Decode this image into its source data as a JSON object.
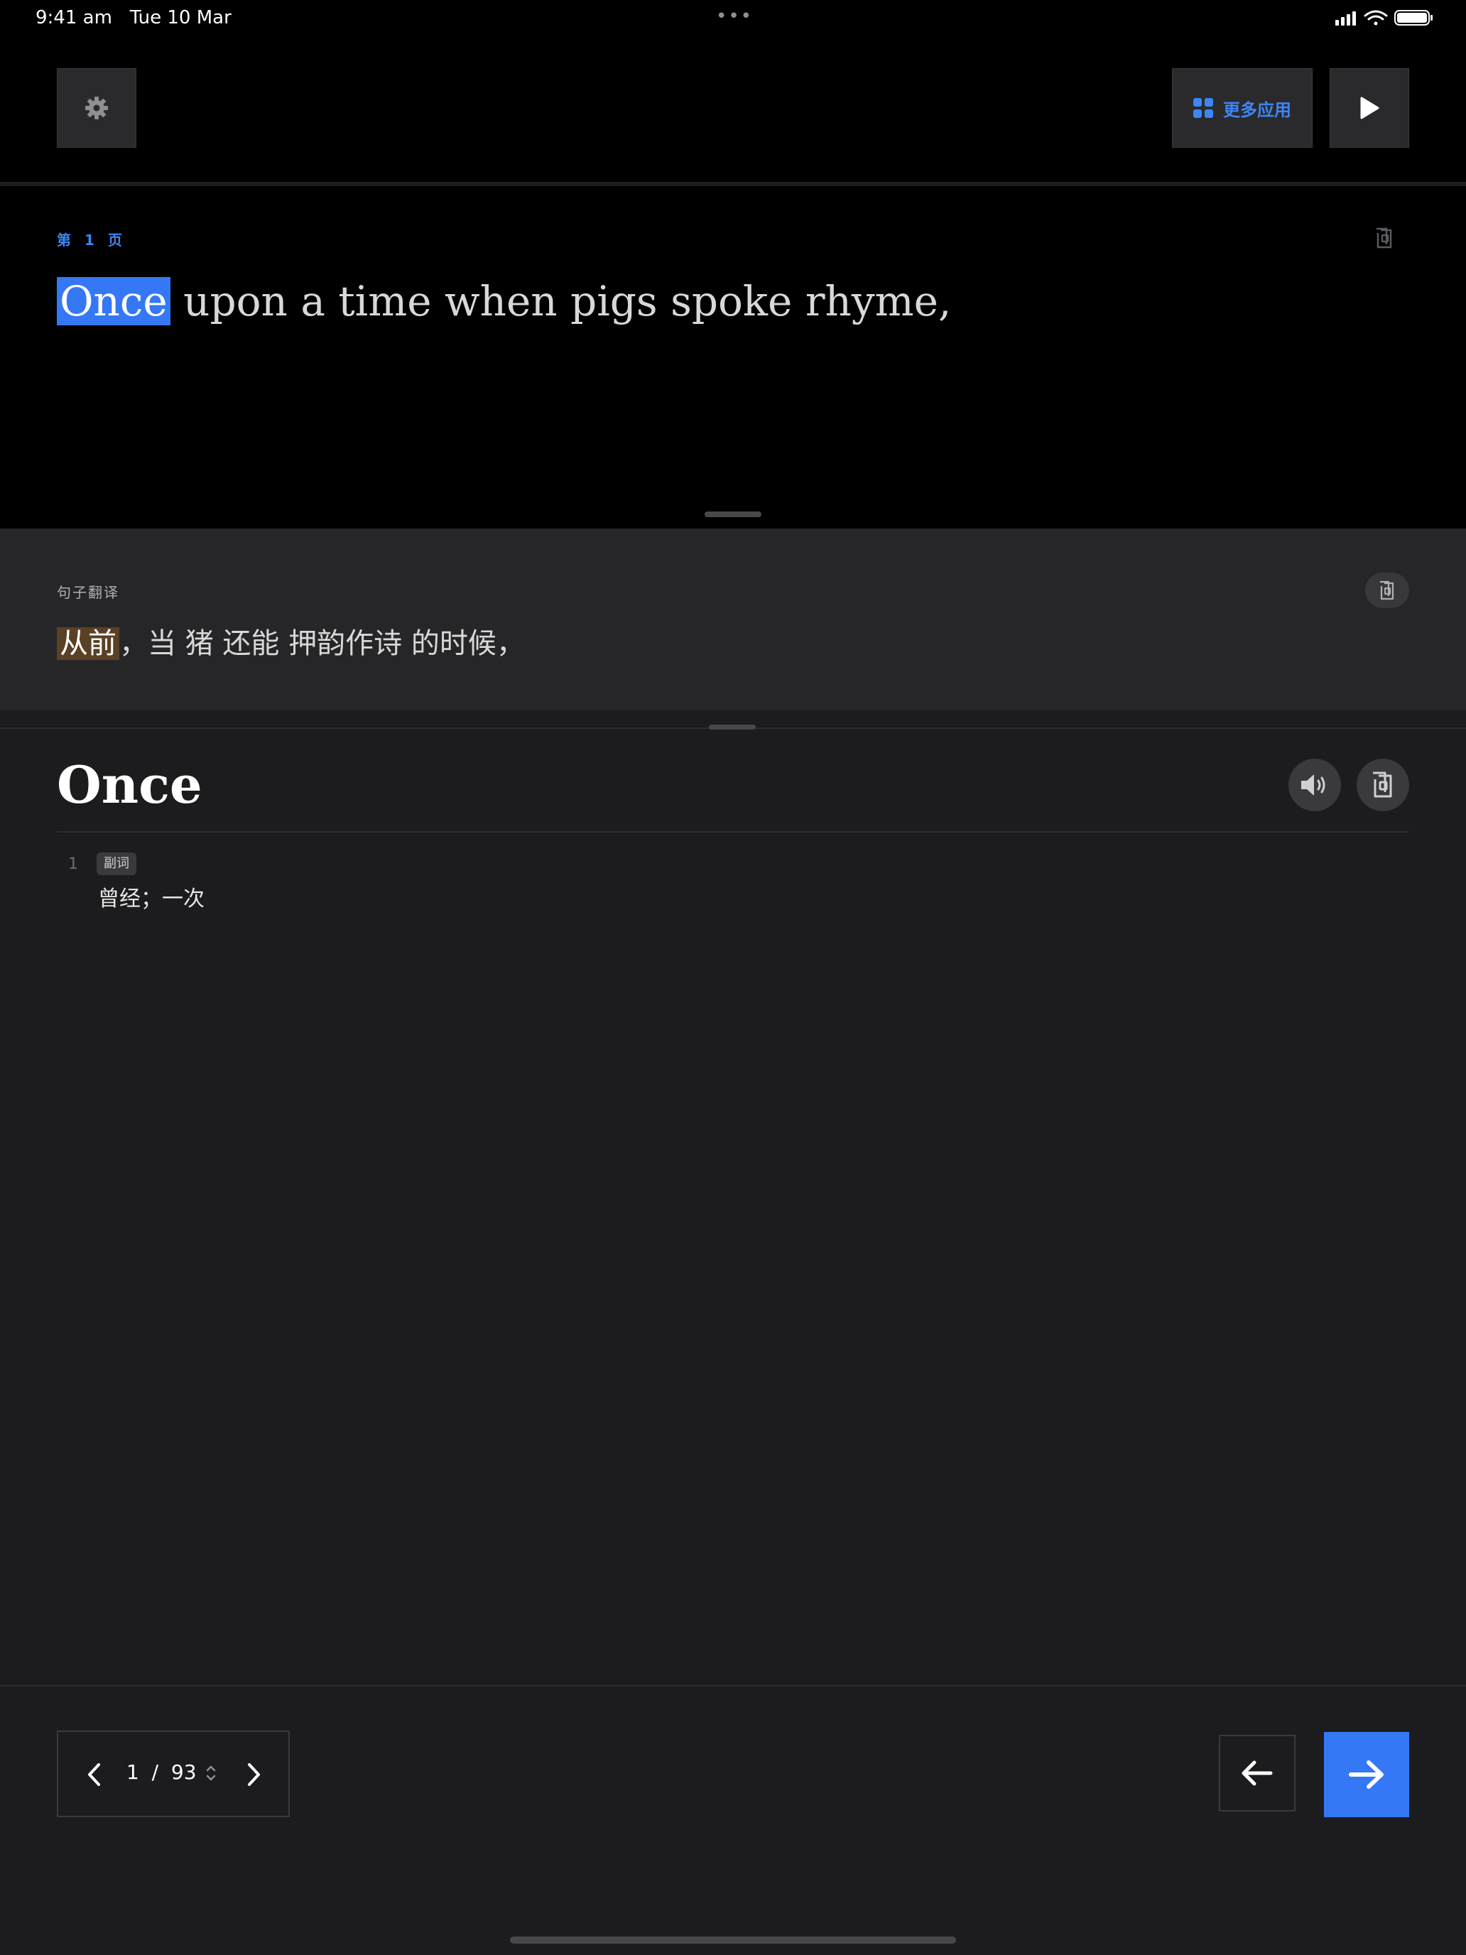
{
  "status_bar": {
    "time": "9:41 am",
    "date": "Tue 10 Mar",
    "dots": "•••"
  },
  "toolbar": {
    "settings_icon": "gear-icon",
    "more_apps_label": "更多应用",
    "more_apps_icon": "grid-icon",
    "play_icon": "play-icon"
  },
  "reader": {
    "page_label": "第 1 页",
    "highlighted_word": "Once",
    "sentence_rest": " upon a time when pigs spoke rhyme,"
  },
  "translation": {
    "label": "句子翻译",
    "highlighted": "从前",
    "rest": "，当 猪 还能 押韵作诗 的时候，"
  },
  "dictionary": {
    "headword": "Once",
    "definitions": [
      {
        "number": "1",
        "pos": "副词",
        "meaning": "曾经；一次"
      }
    ]
  },
  "pagination": {
    "current": "1",
    "separator": "/",
    "total": "93"
  },
  "colors": {
    "accent": "#3478f6",
    "word_highlight": "#3478f6",
    "translation_highlight": "#5a4025"
  }
}
